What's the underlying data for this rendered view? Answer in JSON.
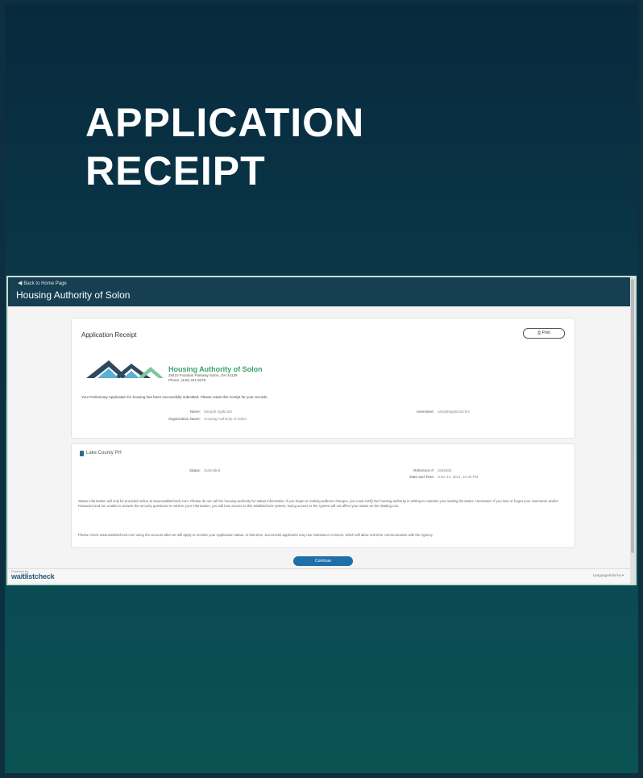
{
  "slide": {
    "title_line1": "APPLICATION",
    "title_line2": "RECEIPT"
  },
  "app": {
    "back_label": "Back to Home Page",
    "authority_name": "Housing Authority of Solon"
  },
  "receipt": {
    "title": "Application Receipt",
    "print_label": "Print",
    "org_name": "Housing Authority of Solon",
    "org_address": "28410 Fountain Parkway Solon, OH 44139",
    "org_phone": "Phone: (440) 321-8376",
    "confirmation": "Your Preliminary Application for housing has been successfully submitted. Please retain this receipt for your records.",
    "fields": {
      "name_label": "Name:",
      "name_value": "Sample Applicant",
      "username_label": "Username:",
      "username_value": "sampleapplicant.hm",
      "org_label": "Organization Name:",
      "org_value": "Housing Authority of Solon"
    }
  },
  "waitlist": {
    "name": "Lake County PH",
    "status_label": "Status:",
    "status_value": "Submitted",
    "reference_label": "Reference #:",
    "reference_value": "2048305",
    "date_label": "Date and Time:",
    "date_value": "June 14, 2021, 10:39 PM",
    "para1": "Status information will only be provided online at www.waitlistcheck.com. Please do not call the housing authority for status information. If you forget or making address changes, you must notify the housing authority in writing to maintain your waiting list status. Username: If you lose or forget your Username and/or Password and are unable to answer the security questions to retrieve your information, you will lose access to this Waitlistcheck system, losing access to the system will not affect your status on the Waiting List.",
    "para2": "Please check www.waitlistcheck.com using the account after we still apply to monitor your Application status. At that time, Successful applicants may use Assistance Connect, which will allow real time communication with the Agency."
  },
  "actions": {
    "continue_label": "Continue"
  },
  "footer": {
    "brand": "waitlistcheck",
    "brand_small": "Powered by",
    "language": "Language/Idioma ▾"
  },
  "colors": {
    "topbar": "#173f52",
    "accent_green": "#3aa36e",
    "button_blue": "#1f6fa8"
  }
}
